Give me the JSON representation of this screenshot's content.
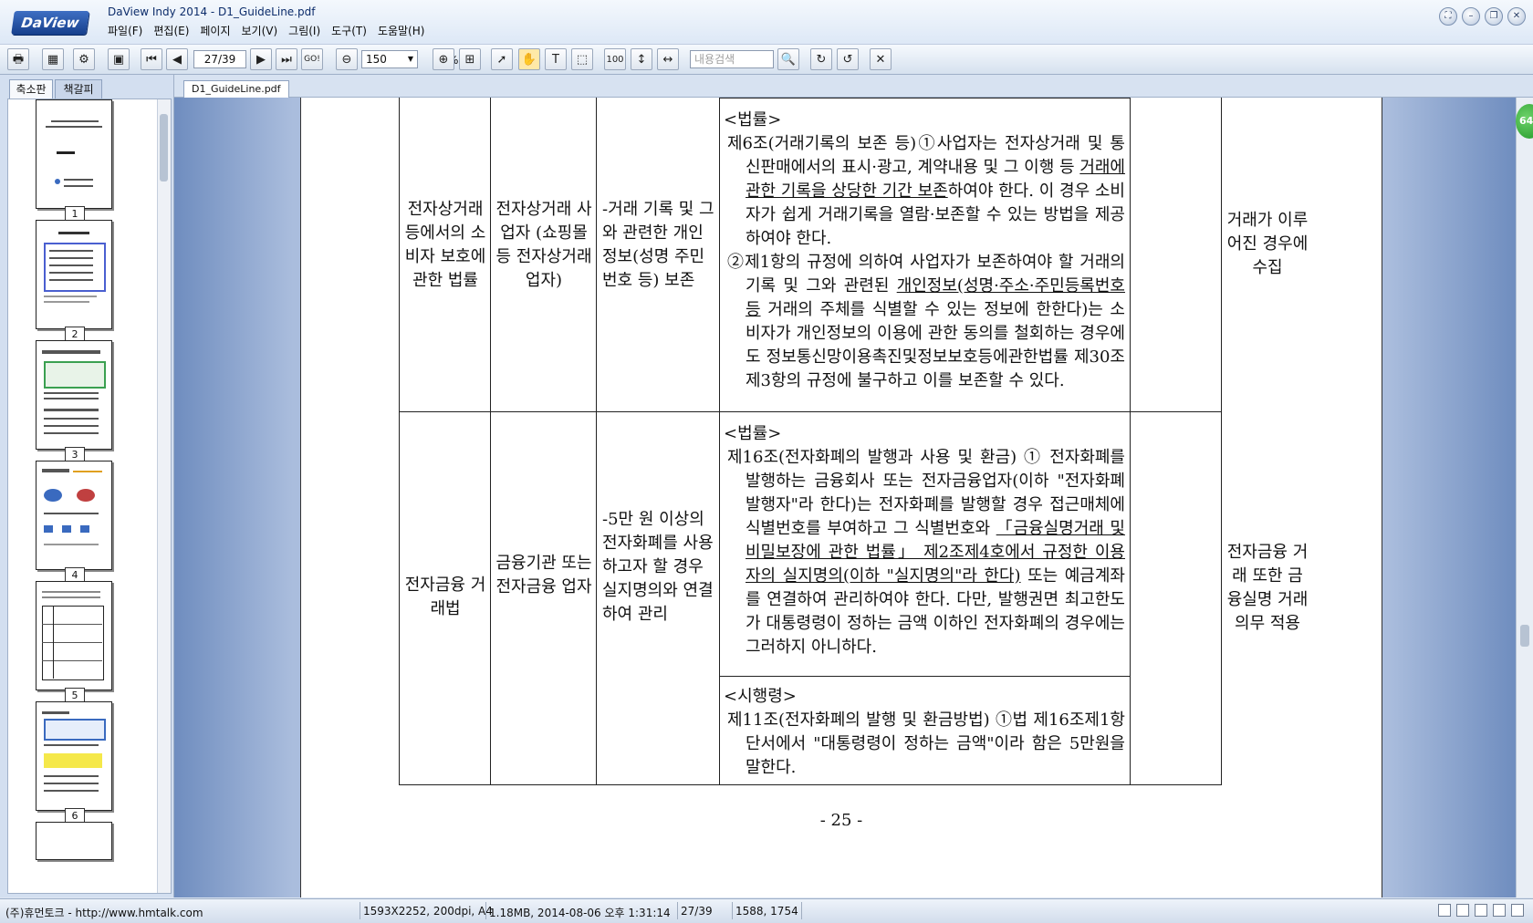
{
  "app": {
    "logo": "DaView",
    "title": "DaView Indy 2014 - D1_GuideLine.pdf",
    "menu": [
      "파일(F)",
      "편집(E)",
      "페이지",
      "보기(V)",
      "그림(I)",
      "도구(T)",
      "도움말(H)"
    ]
  },
  "toolbar": {
    "page_value": "27/39",
    "goto_label": "GO!",
    "zoom_value": "150",
    "zoom_unit": "%",
    "search_placeholder": "내용검색"
  },
  "left_panel": {
    "tabs": [
      "축소판",
      "책갈피"
    ],
    "thumb_numbers": [
      "1",
      "2",
      "3",
      "4",
      "5",
      "6"
    ]
  },
  "document": {
    "tab_label": "D1_GuideLine.pdf",
    "badge": "64",
    "page_number": "- 25 -",
    "row1": {
      "law_name": "전자상거래 등에서의 소비자 보호에 관한 법률",
      "target": "전자상거래 사업자 (쇼핑몰 등 전자상거래 업자)",
      "info": "-거래 기록 및 그와 관련한 개인정보(성명 주민번호 등) 보존",
      "text_header": "<법률>",
      "text_a1": "제6조(거래기록의 보존 등)①사업자는 전자상거래 및 통신판매에서의 표시·광고, 계약내용 및 그 이행 등 ",
      "text_a2": "거래에 관한 기록을 상당한 기간 보존",
      "text_a3": "하여야 한다. 이 경우 소비자가 쉽게 거래기록을 열람·보존할 수 있는 방법을 제공하여야 한다.",
      "text_b1": "②제1항의 규정에 의하여 사업자가 보존하여야 할 거래의 기록 및 그와 관련된 ",
      "text_b2": "개인정보(성명·주소·주민등록번호 등",
      "text_b3": " 거래의 주체를 식별할 수 있는 정보에 한한다)는 소비자가 개인정보의 이용에 관한 동의를 철회하는 경우에도 정보통신망이용촉진및정보보호등에관한법률 제30조제3항의 규정에 불구하고 이를 보존할 수 있다.",
      "timing": "거래가 이루어진 경우에 수집"
    },
    "row2": {
      "law_name": "전자금융 거래법",
      "target": "금융기관 또는 전자금융 업자",
      "info": "-5만 원 이상의 전자화폐를 사용하고자 할 경우 실지명의와 연결하여 관리",
      "law_header": "<법률>",
      "law_a1": "제16조(전자화폐의 발행과 사용 및 환금) ① 전자화폐를 발행하는 금융회사 또는 전자금융업자(이하 \"전자화폐발행자\"라 한다)는 전자화폐를 발행할 경우 접근매체에 식별번호를 부여하고 그 식별번호와 ",
      "law_a2": "「금융실명거래 및 비밀보장에 관한 법률」 제2조제4호에서 규정한 이용자의 실지명의(이하 \"실지명의\"라 한다)",
      "law_a3": " 또는 예금계좌를 연결하여 관리하여야 한다. 다만, 발행권면 최고한도가 대통령령이 정하는 금액 이하인 전자화폐의 경우에는 그러하지 아니하다.",
      "decree_header": "<시행령>",
      "decree_text": "제11조(전자화폐의 발행 및 환금방법) ①법 제16조제1항 단서에서 \"대통령령이 정하는 금액\"이라 함은 5만원을 말한다.",
      "timing": "전자금융 거래 또한 금융실명 거래 의무 적용"
    }
  },
  "status": {
    "company": "(주)휴먼토크 - http://www.hmtalk.com",
    "image_info": "1593X2252, 200dpi, A4",
    "file_info": "1.18MB, 2014-08-06 오후 1:31:14",
    "page": "27/39",
    "coords": "1588, 1754"
  }
}
